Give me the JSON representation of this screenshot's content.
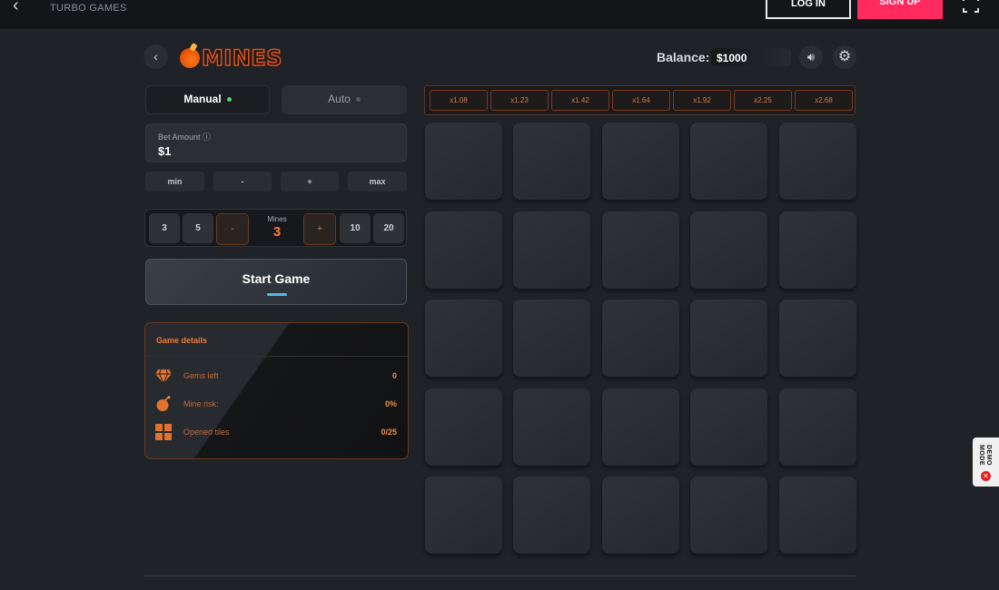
{
  "topbar": {
    "title": "TURBO GAMES",
    "login": "LOG IN",
    "signup": "SIGN UP"
  },
  "header": {
    "logo_text": "MINES",
    "balance_label": "Balance:",
    "balance_value": "$1000"
  },
  "modes": [
    {
      "label": "Manual",
      "active": true,
      "dot_color": "#4cd964"
    },
    {
      "label": "Auto",
      "active": false,
      "dot_color": "#555a60"
    }
  ],
  "bet": {
    "label": "Bet Amount",
    "value": "$1",
    "buttons": [
      "min",
      "-",
      "+",
      "max"
    ]
  },
  "mines": {
    "label": "Mines",
    "value": "3",
    "presets_left": [
      "3",
      "5"
    ],
    "presets_right": [
      "10",
      "20"
    ],
    "decrement": "-",
    "increment": "+"
  },
  "start_button": {
    "label": "Start Game"
  },
  "details": {
    "title": "Game details",
    "rows": [
      {
        "icon": "diamond-icon",
        "label": "Gems left",
        "value": "0"
      },
      {
        "icon": "bomb-icon",
        "label": "Mine risk:",
        "value": "0%"
      },
      {
        "icon": "grid-icon",
        "label": "Opened tiles",
        "value": "0/25"
      }
    ]
  },
  "multipliers": [
    "x1.08",
    "x1.23",
    "x1.42",
    "x1.64",
    "x1.92",
    "x2.25",
    "x2.68"
  ],
  "grid": {
    "rows": 5,
    "cols": 5
  },
  "demo_badge": {
    "text": "DEMO MODE"
  },
  "colors": {
    "accent": "#ff7b2e",
    "signup": "#ff2b5e",
    "start_underline": "#55b8e8"
  }
}
